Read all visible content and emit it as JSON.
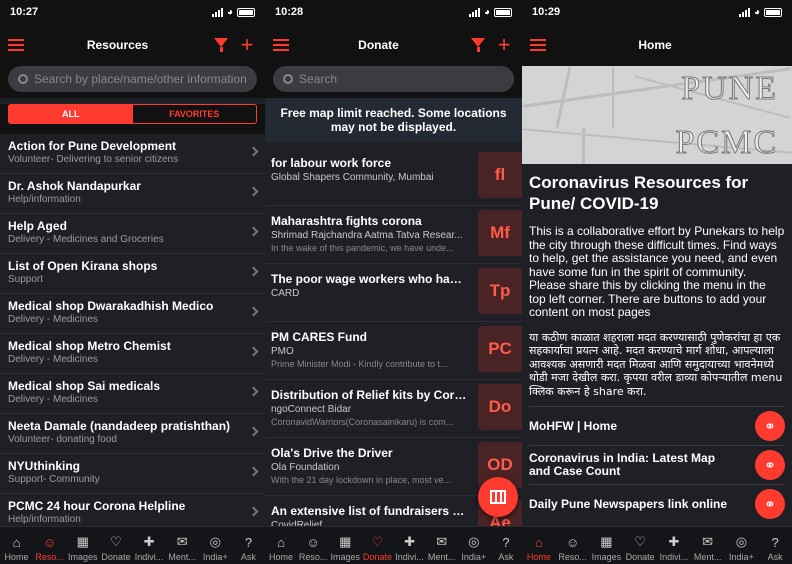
{
  "colors": {
    "accent": "#ff3b30",
    "background": "#1e2026",
    "bar": "#111111"
  },
  "screen1": {
    "time": "10:27",
    "title": "Resources",
    "search_placeholder": "Search by place/name/other information",
    "segments": [
      "ALL",
      "FAVORITES"
    ],
    "items": [
      {
        "title": "Action for Pune Development",
        "subtitle": "Volunteer- Delivering to senior citizens"
      },
      {
        "title": "Dr. Ashok Nandapurkar",
        "subtitle": "Help/information"
      },
      {
        "title": "Help Aged",
        "subtitle": "Delivery - Medicines and Groceries"
      },
      {
        "title": "List of Open Kirana shops",
        "subtitle": "Support"
      },
      {
        "title": "Medical shop Dwarakadhish Medico",
        "subtitle": "Delivery - Medicines"
      },
      {
        "title": "Medical shop Metro Chemist",
        "subtitle": "Delivery - Medicines"
      },
      {
        "title": "Medical shop Sai medicals",
        "subtitle": "Delivery - Medicines"
      },
      {
        "title": "Neeta Damale (nandadeep pratishthan)",
        "subtitle": "Volunteer- donating food"
      },
      {
        "title": "NYUthinking",
        "subtitle": "Support- Community"
      },
      {
        "title": "PCMC 24 hour Corona Helpline",
        "subtitle": "Help/information"
      }
    ],
    "tabs": [
      "Home",
      "Reso...",
      "Images",
      "Donate",
      "Indivi...",
      "Ment...",
      "India+",
      "Ask"
    ]
  },
  "screen2": {
    "time": "10:28",
    "title": "Donate",
    "search_placeholder": "Search",
    "banner": "Free map limit reached. Some locations may not be displayed.",
    "items": [
      {
        "title": "for labour work force",
        "org": "Global Shapers Community, Mumbai",
        "desc": "",
        "abbr": "fl"
      },
      {
        "title": "Maharashtra fights corona",
        "org": "Shrimad Rajchandra Aatma Tatva Resear...",
        "desc": "In the wake of this pandemic, we have unde...",
        "abbr": "Mf"
      },
      {
        "title": "The poor wage workers who have n...",
        "org": "CARD",
        "desc": "",
        "abbr": "Tp"
      },
      {
        "title": "PM CARES Fund",
        "org": "PMO",
        "desc": "Prime Minister Modi - Kindly contribute to t...",
        "abbr": "PC"
      },
      {
        "title": "Distribution of Relief kits by Corona...",
        "org": "ngoConnect Bidar",
        "desc": "CoronavidWarriors(Coronasainikaru) is com...",
        "abbr": "Do"
      },
      {
        "title": "Ola's Drive the Driver",
        "org": "Ola Foundation",
        "desc": "With the 21 day lockdown in place, most ve...",
        "abbr": "OD"
      },
      {
        "title": "An extensive list of fundraisers put t...",
        "org": "CovidRelief",
        "desc": "",
        "abbr": "Ae"
      }
    ],
    "tabs": [
      "Home",
      "Reso...",
      "Images",
      "Donate",
      "Indivi...",
      "Ment...",
      "India+",
      "Ask"
    ]
  },
  "screen3": {
    "time": "10:29",
    "title": "Home",
    "hero_line1": "PUNE",
    "hero_line2": "PCMC",
    "heading": "Coronavirus Resources for Pune/ COVID-19",
    "paragraph_en": "This is a collaborative effort by Punekars to help the city through these difficult times. Find ways to help, get the assistance you need, and even have some fun in the spirit of community. Please share this by clicking the menu in the top left corner. There are buttons to add your content on most pages",
    "paragraph_mr": "या कठीण काळात शहराला मदत करण्यासाठी पुणेकरांचा हा एक सहकार्याचा प्रयत्न आहे. मदत करण्याचे मार्ग शोधा, आपल्याला आवश्यक असणारी मदत मिळवा आणि समुदायाच्या भावनेमध्ये थोडी मजा देखील करा. कृपया वरील डाव्या कोपऱ्यातील menu क्लिक करून हे share करा.",
    "links": [
      "MoHFW | Home",
      "Coronavirus in India: Latest Map and Case Count",
      "Daily Pune Newspapers link online"
    ],
    "tabs": [
      "Home",
      "Reso...",
      "Images",
      "Donate",
      "Indivi...",
      "Ment...",
      "India+",
      "Ask"
    ]
  }
}
